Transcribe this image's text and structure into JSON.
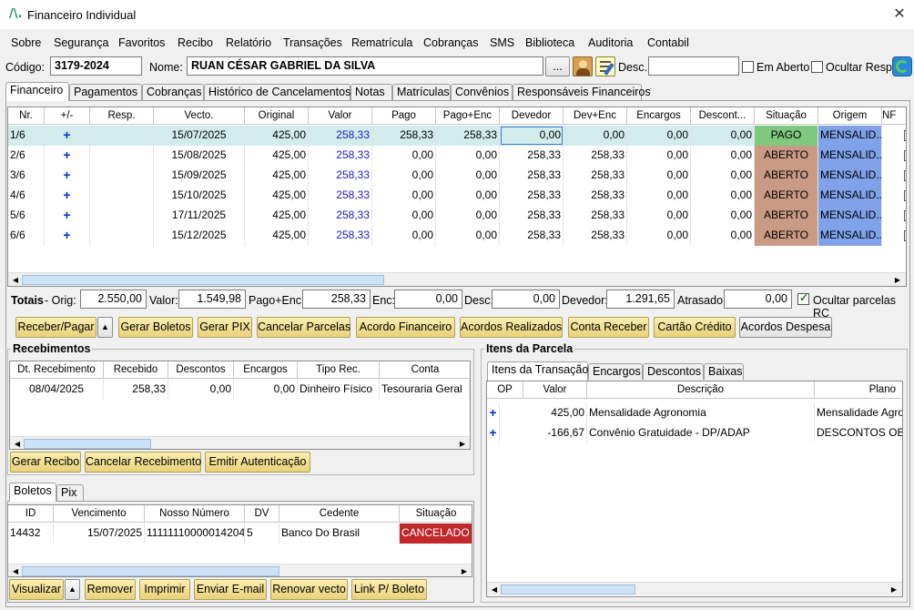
{
  "window": {
    "title": "Financeiro Individual",
    "close": "✕",
    "app_icon": "/\\."
  },
  "menu": [
    "Sobre",
    "Segurança",
    "Favoritos",
    "Recibo",
    "Relatório",
    "Transações",
    "Rematrícula",
    "Cobranças",
    "SMS",
    "Biblioteca",
    "Auditoria",
    "Contabil"
  ],
  "header": {
    "codigo_label": "Código:",
    "codigo": "3179-2024",
    "nome_label": "Nome:",
    "nome": "RUAN CÉSAR GABRIEL DA SILVA",
    "browse": "...",
    "desc_label": "Desc.:",
    "desc": "",
    "em_aberto": "Em Aberto",
    "ocultar_resp": "Ocultar Resp."
  },
  "main_tabs": [
    "Financeiro",
    "Pagamentos",
    "Cobranças",
    "Histórico de Cancelamentos",
    "Notas",
    "Matrículas",
    "Convênios",
    "Responsáveis Financeiros"
  ],
  "parcelas": {
    "columns": [
      "Nr.",
      "+/-",
      "Resp.",
      "Vecto.",
      "Original",
      "Valor",
      "Pago",
      "Pago+Enc",
      "Devedor",
      "Dev+Enc",
      "Encargos",
      "Descont...",
      "Situação",
      "Origem",
      "NF"
    ],
    "rows": [
      [
        "1/6",
        "+",
        "",
        "15/07/2025",
        "425,00",
        "258,33",
        "258,33",
        "258,33",
        "0,00",
        "0,00",
        "0,00",
        "0,00",
        "PAGO",
        "MENSALID..."
      ],
      [
        "2/6",
        "+",
        "",
        "15/08/2025",
        "425,00",
        "258,33",
        "0,00",
        "0,00",
        "258,33",
        "258,33",
        "0,00",
        "0,00",
        "ABERTO",
        "MENSALID..."
      ],
      [
        "3/6",
        "+",
        "",
        "15/09/2025",
        "425,00",
        "258,33",
        "0,00",
        "0,00",
        "258,33",
        "258,33",
        "0,00",
        "0,00",
        "ABERTO",
        "MENSALID..."
      ],
      [
        "4/6",
        "+",
        "",
        "15/10/2025",
        "425,00",
        "258,33",
        "0,00",
        "0,00",
        "258,33",
        "258,33",
        "0,00",
        "0,00",
        "ABERTO",
        "MENSALID..."
      ],
      [
        "5/6",
        "+",
        "",
        "17/11/2025",
        "425,00",
        "258,33",
        "0,00",
        "0,00",
        "258,33",
        "258,33",
        "0,00",
        "0,00",
        "ABERTO",
        "MENSALID..."
      ],
      [
        "6/6",
        "+",
        "",
        "15/12/2025",
        "425,00",
        "258,33",
        "0,00",
        "0,00",
        "258,33",
        "258,33",
        "0,00",
        "0,00",
        "ABERTO",
        "MENSALID..."
      ]
    ]
  },
  "totals": {
    "label": "Totais",
    "orig_label": "- Orig:",
    "orig": "2.550,00",
    "valor_label": "Valor:",
    "valor": "1.549,98",
    "pago_enc_label": "Pago+Enc:",
    "pago_enc": "258,33",
    "enc_label": "Enc:",
    "enc": "0,00",
    "desc_label": "Desc:",
    "desc": "0,00",
    "devedor_label": "Devedor:",
    "devedor": "1.291,65",
    "atrasado_label": "Atrasado:",
    "atrasado": "0,00",
    "ocultar_label": "Ocultar parcelas RC"
  },
  "actions": [
    "Receber/Pagar",
    "Gerar Boletos",
    "Gerar PIX",
    "Cancelar Parcelas",
    "Acordo Financeiro",
    "Acordos Realizados",
    "Conta Receber",
    "Cartão Crédito",
    "Acordos Despesa"
  ],
  "recebimentos": {
    "title": "Recebimentos",
    "columns": [
      "Dt. Recebimento",
      "Recebido",
      "Descontos",
      "Encargos",
      "Tipo Rec.",
      "Conta"
    ],
    "rows": [
      [
        "08/04/2025",
        "258,33",
        "0,00",
        "0,00",
        "Dinheiro Físico",
        "Tesouraria Geral"
      ]
    ],
    "buttons": [
      "Gerar Recibo",
      "Cancelar Recebimento",
      "Emitir Autenticação"
    ]
  },
  "boletos": {
    "tabs": [
      "Boletos",
      "Pix"
    ],
    "columns": [
      "ID",
      "Vencimento",
      "Nosso Número",
      "DV",
      "Cedente",
      "Situação"
    ],
    "rows": [
      [
        "14432",
        "15/07/2025",
        "11111110000014204",
        "5",
        "Banco Do Brasil",
        "CANCELADO"
      ]
    ],
    "buttons": [
      "Visualizar",
      "Remover",
      "Imprimir",
      "Enviar E-mail",
      "Renovar vecto",
      "Link P/ Boleto"
    ]
  },
  "itens": {
    "title": "Itens da Parcela",
    "tabs": [
      "Itens da Transação",
      "Encargos",
      "Descontos",
      "Baixas"
    ],
    "columns": [
      "OP",
      "Valor",
      "Descrição",
      "Plano"
    ],
    "rows": [
      [
        "+",
        "425,00",
        "Mensalidade Agronomia",
        "Mensalidade Agro"
      ],
      [
        "+",
        "-166,67",
        "Convênio Gratuidade - DP/ADAP",
        "DESCONTOS OBT"
      ]
    ]
  },
  "colors": {
    "pago": "#7fc97f",
    "aberto": "#c99a84",
    "origem": "#7fa2ea",
    "cancelado": "#c0282a",
    "selected_row": "#d2ecec",
    "valor_text": "#1a1acc"
  }
}
